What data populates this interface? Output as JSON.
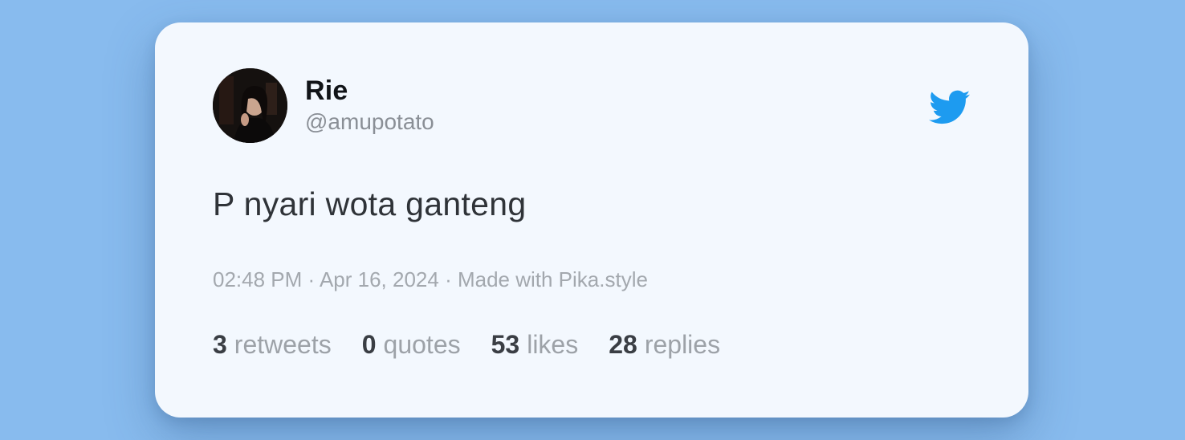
{
  "tweet": {
    "author_name": "Rie",
    "author_handle": "@amupotato",
    "text": "P nyari wota ganteng",
    "meta": "02:48 PM · Apr 16, 2024 · Made with Pika.style",
    "stats": [
      {
        "count": "3",
        "label": "retweets"
      },
      {
        "count": "0",
        "label": "quotes"
      },
      {
        "count": "53",
        "label": "likes"
      },
      {
        "count": "28",
        "label": "replies"
      }
    ]
  },
  "icons": {
    "brand": "twitter-bird-icon",
    "avatar": "profile-photo"
  },
  "colors": {
    "background": "#88bbee",
    "card": "#f3f8fe",
    "brand": "#1d9bf0"
  }
}
